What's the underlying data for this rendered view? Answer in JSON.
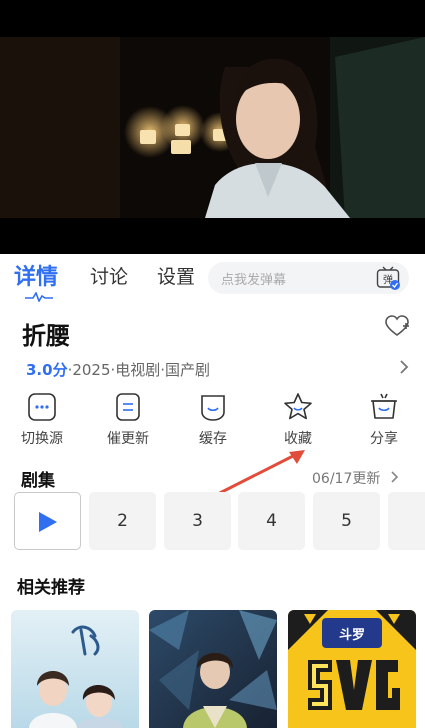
{
  "detail_tabs": {
    "details": "详情",
    "discuss": "讨论",
    "settings": "设置"
  },
  "danmaku_placeholder": "点我发弹幕",
  "danmaku_badge": "弹",
  "show": {
    "title": "折腰",
    "score": "3.0分",
    "info": "·2025·电视剧·国产剧"
  },
  "actions": [
    {
      "label": "切换源",
      "icon": "more-icon"
    },
    {
      "label": "催更新",
      "icon": "list-icon"
    },
    {
      "label": "缓存",
      "icon": "download-icon"
    },
    {
      "label": "收藏",
      "icon": "star-icon"
    },
    {
      "label": "分享",
      "icon": "share-icon"
    }
  ],
  "episodes": {
    "header": "剧集",
    "update": "06/17更新",
    "list": [
      "2",
      "3",
      "4",
      "5"
    ]
  },
  "related": {
    "header": "相关推荐",
    "badge_text": "斗罗"
  },
  "colors": {
    "accent": "#2f6ff0",
    "arrow": "#e24c3a"
  }
}
